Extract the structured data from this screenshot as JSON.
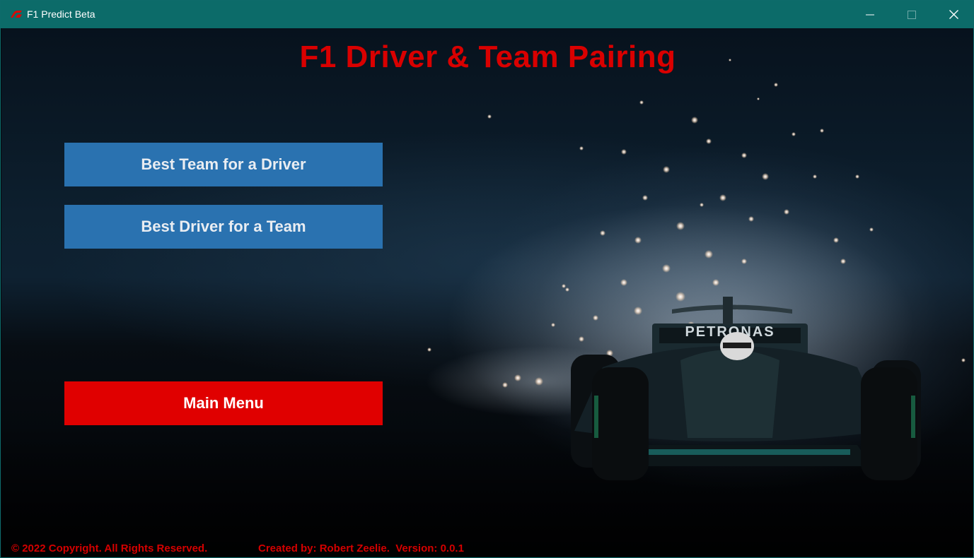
{
  "window": {
    "title": "F1 Predict Beta",
    "icon": "f1-logo-icon",
    "controls": {
      "minimize": "minimize-icon",
      "maximize": "maximize-icon",
      "close": "close-icon"
    }
  },
  "colors": {
    "titlebar": "#0c6b69",
    "title_text": "#d90000",
    "button_blue": "#2a72b0",
    "button_red": "#e00000",
    "footer_text": "#d40000"
  },
  "main": {
    "title": "F1 Driver & Team Pairing",
    "buttons": {
      "best_team": "Best Team for a Driver",
      "best_driver": "Best Driver for a Team",
      "main_menu": "Main Menu"
    }
  },
  "footer": {
    "copyright": "© 2022 Copyright. All Rights Reserved.",
    "credits": "Created by: Robert Zeelie.  Version: 0.0.1"
  }
}
